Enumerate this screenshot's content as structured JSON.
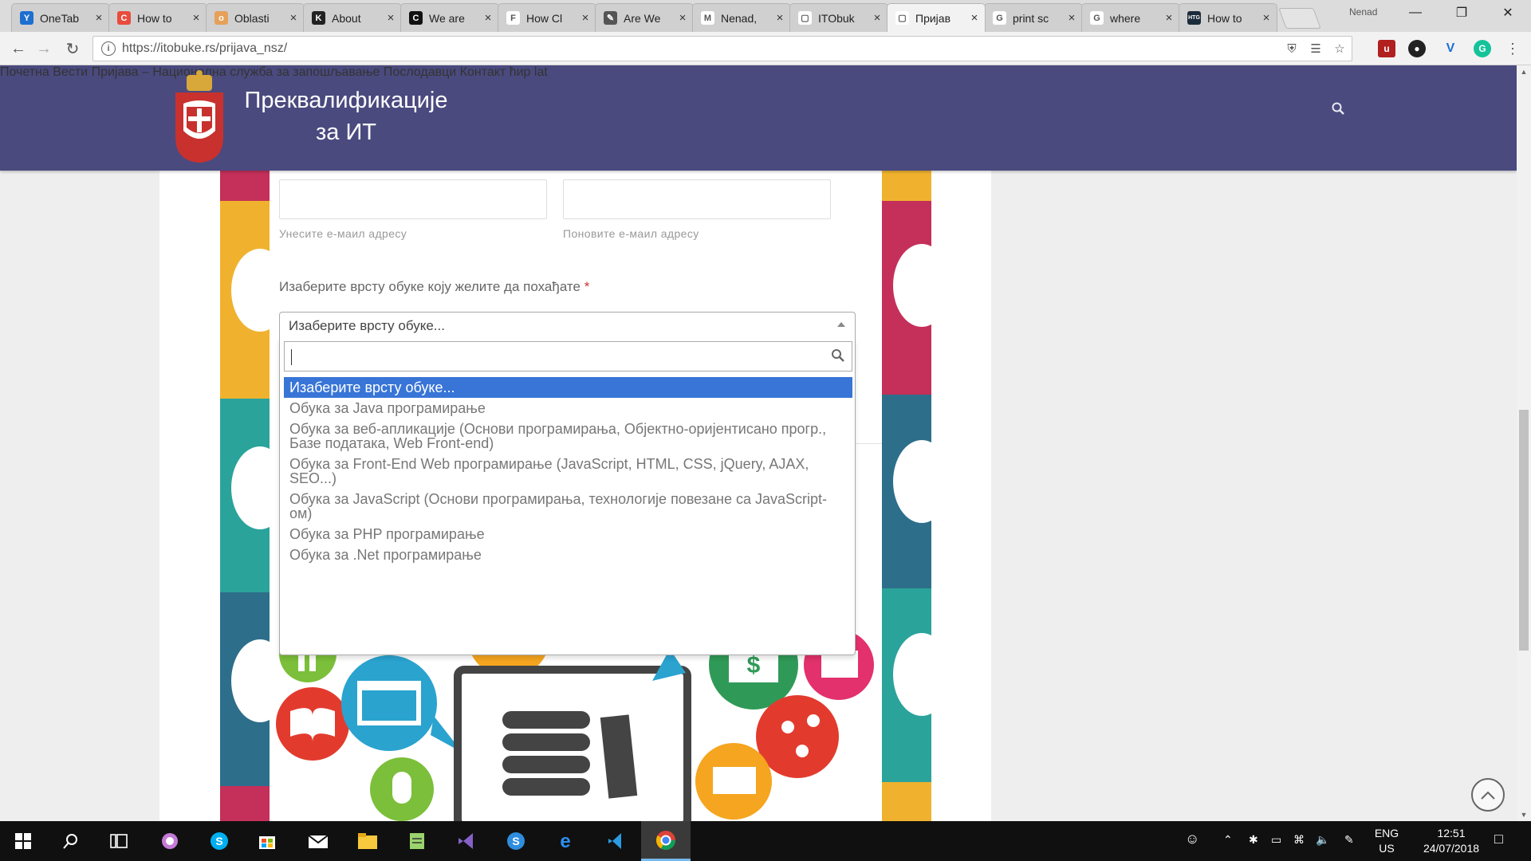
{
  "browser": {
    "tabs": [
      {
        "label": "OneTab",
        "favicon_color": "#1e6fd0",
        "favicon_glyph": "Y"
      },
      {
        "label": "How to",
        "favicon_color": "#e84c3d",
        "favicon_glyph": "C"
      },
      {
        "label": "Oblasti",
        "favicon_color": "#e6a05a",
        "favicon_glyph": "o"
      },
      {
        "label": "About",
        "favicon_color": "#222222",
        "favicon_glyph": "K"
      },
      {
        "label": "We are",
        "favicon_color": "#111111",
        "favicon_glyph": "C"
      },
      {
        "label": "How Cl",
        "favicon_color": "#ffffff",
        "favicon_glyph": "F"
      },
      {
        "label": "Are We",
        "favicon_color": "#555555",
        "favicon_glyph": "✎"
      },
      {
        "label": "Nenad,",
        "favicon_color": "#ffffff",
        "favicon_glyph": "M"
      },
      {
        "label": "ITObuk",
        "favicon_color": "#ffffff",
        "favicon_glyph": "▢"
      },
      {
        "label": "Пријав",
        "favicon_color": "#ffffff",
        "favicon_glyph": "▢",
        "active": true
      },
      {
        "label": "print sc",
        "favicon_color": "#ffffff",
        "favicon_glyph": "G"
      },
      {
        "label": "where",
        "favicon_color": "#ffffff",
        "favicon_glyph": "G"
      },
      {
        "label": "How to",
        "favicon_color": "#1b2b3a",
        "favicon_glyph": "HTG"
      }
    ],
    "profile_name": "Nenad",
    "url": "https://itobuke.rs/prijava_nsz/"
  },
  "site": {
    "title_line1": "Преквалификације",
    "title_line2": "за ИТ",
    "nav": [
      "Почетна",
      "Вести",
      "Пријава – Национална служба за запошљавање",
      "Послодавци",
      "Контакт",
      "ћир",
      "lat"
    ],
    "header_color": "#4a4a7f"
  },
  "form": {
    "email_hint": "Унесите е-маил адресу",
    "email_confirm_hint": "Поновите е-маил адресу",
    "training_question": "Изаберите врсту обуке коју желите да похађате",
    "required_mark": "*",
    "select_value": "Изаберите врсту обуке...",
    "search_value": "",
    "options": [
      "Изаберите врсту обуке...",
      "Обука за Java програмирање",
      "Обука за веб-апликације (Основи програмирања, Објектно-оријентисано прогр., Базе података, Web Front-end)",
      "Обука за Front-End Web програмирање (JavaScript, HTML, CSS, jQuery, AJAX, SEO...)",
      "Обука за JavaScript (Основи програмирања, технологије повезане са JavaScript-ом)",
      "Обука за PHP програмирање",
      "Обука за .Net програмирање"
    ],
    "selected_index": 0
  },
  "taskbar": {
    "language_line1": "ENG",
    "language_line2": "US",
    "time": "12:51",
    "date": "24/07/2018"
  }
}
